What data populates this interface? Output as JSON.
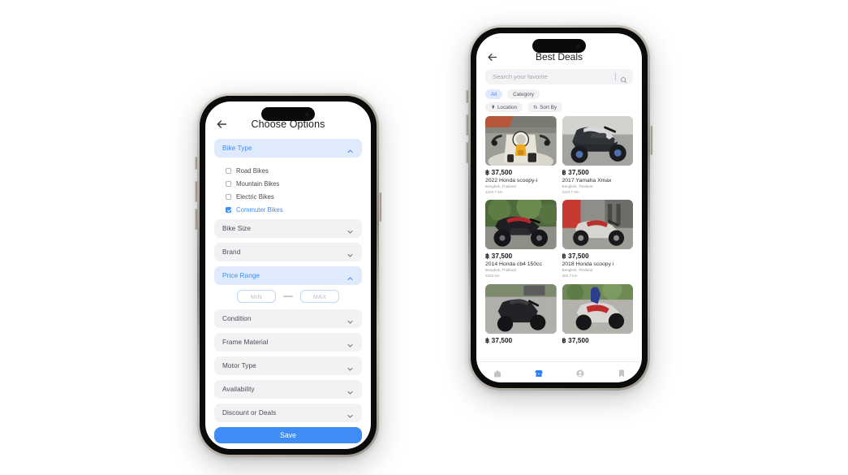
{
  "left_phone": {
    "header": {
      "back_icon": "arrow-left-icon",
      "title": "Choose Options"
    },
    "filters": [
      {
        "label": "Bike Type",
        "expanded": true,
        "icon": "chevron-up-icon"
      },
      {
        "label": "Bike Size",
        "expanded": false,
        "icon": "chevron-down-icon"
      },
      {
        "label": "Brand",
        "expanded": false,
        "icon": "chevron-down-icon"
      },
      {
        "label": "Price Range",
        "expanded": true,
        "icon": "chevron-up-icon"
      },
      {
        "label": "Condition",
        "expanded": false,
        "icon": "chevron-down-icon"
      },
      {
        "label": "Frame Material",
        "expanded": false,
        "icon": "chevron-down-icon"
      },
      {
        "label": "Motor Type",
        "expanded": false,
        "icon": "chevron-down-icon"
      },
      {
        "label": "Availability",
        "expanded": false,
        "icon": "chevron-down-icon"
      },
      {
        "label": "Discount or Deals",
        "expanded": false,
        "icon": "chevron-down-icon"
      }
    ],
    "bike_type_options": [
      {
        "label": "Road Bikes",
        "checked": false
      },
      {
        "label": "Mountain Bikes",
        "checked": false
      },
      {
        "label": "Electric Bikes",
        "checked": false
      },
      {
        "label": "Commuter Bikes",
        "checked": true
      }
    ],
    "price_range": {
      "min_placeholder": "MIN",
      "max_placeholder": "MAX",
      "min_value": "",
      "max_value": "",
      "separator": "—"
    },
    "save_label": "Save",
    "accent_color": "#3f8cf4",
    "highlight_bg": "#dfebfd"
  },
  "right_phone": {
    "header": {
      "back_icon": "arrow-left-icon",
      "title": "Best Deals"
    },
    "search": {
      "placeholder": "Search your favorite",
      "value": "",
      "icon": "search-icon"
    },
    "chips_row1": [
      {
        "label": "All",
        "active": true,
        "icon": null
      },
      {
        "label": "Category",
        "active": false,
        "icon": null
      }
    ],
    "chips_row2": [
      {
        "label": "Location",
        "active": false,
        "icon": "location-pin-icon"
      },
      {
        "label": "Sort By",
        "active": false,
        "icon": "sort-icon"
      }
    ],
    "listings": [
      {
        "price": "฿ 37,500",
        "name": "2022 Honda scoopy-i",
        "location": "Bangkok, Thailand",
        "distance": "1204.7 km",
        "image": "honda-scoopy-yellow"
      },
      {
        "price": "฿ 37,500",
        "name": "2017 Yamaha Xmax",
        "location": "Bangkok, Thailand",
        "distance": "1124.7 km",
        "image": "yamaha-xmax-black"
      },
      {
        "price": "฿ 37,500",
        "name": "2014 Honda cb4 150cc",
        "location": "Bangkok, Thailand",
        "distance": "2323 km",
        "image": "honda-cb4-black"
      },
      {
        "price": "฿ 37,500",
        "name": "2018 Honda scoopy i",
        "location": "Bangkok, Thailand",
        "distance": "302.7 km",
        "image": "honda-scoopy-silver-red"
      },
      {
        "price": "฿ 37,500",
        "name": "",
        "location": "",
        "distance": "",
        "image": "scooter-black"
      },
      {
        "price": "฿ 37,500",
        "name": "",
        "location": "",
        "distance": "",
        "image": "motorbike-red-white"
      }
    ],
    "tabs": [
      {
        "icon": "home-icon",
        "active": false
      },
      {
        "icon": "marketplace-icon",
        "active": true
      },
      {
        "icon": "profile-icon",
        "active": false
      },
      {
        "icon": "bookmark-icon",
        "active": false
      }
    ],
    "accent_color": "#2f7ff0"
  }
}
